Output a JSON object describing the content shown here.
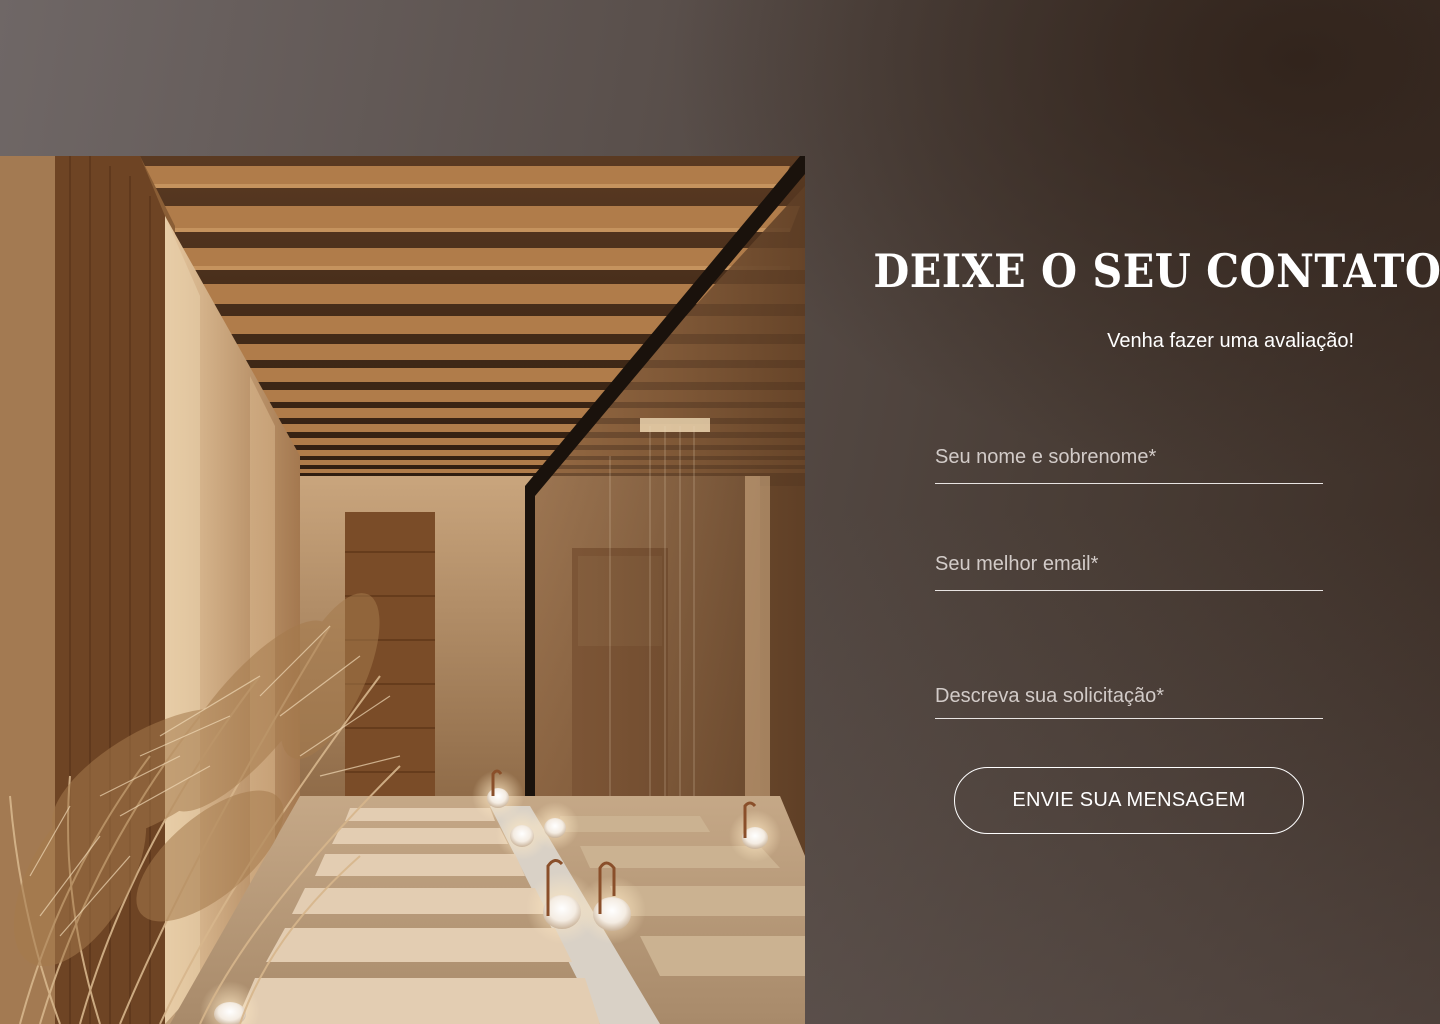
{
  "contact": {
    "title": "DEIXE O SEU CONTATO",
    "subtitle": "Venha fazer uma avaliação!"
  },
  "form": {
    "name_placeholder": "Seu nome e sobrenome*",
    "email_placeholder": "Seu melhor email*",
    "message_placeholder": "Descreva sua solicitação*",
    "submit_label": "ENVIE SUA MENSAGEM"
  },
  "colors": {
    "background_dark": "#3b2d25",
    "background_light": "#6f6766",
    "text": "#ffffff"
  }
}
